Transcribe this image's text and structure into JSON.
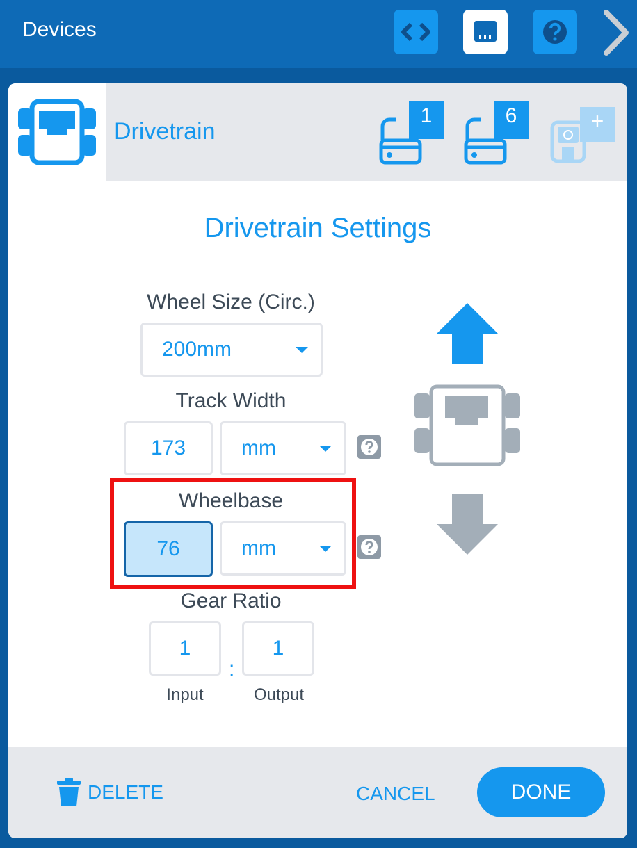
{
  "topbar": {
    "title": "Devices",
    "icons": [
      "code-icon",
      "devices-icon",
      "help-icon",
      "chevron-right-icon"
    ]
  },
  "device": {
    "title": "Drivetrain",
    "ports": [
      {
        "label": "1"
      },
      {
        "label": "6"
      },
      {
        "label": "+"
      }
    ]
  },
  "settings": {
    "title": "Drivetrain Settings",
    "wheel_size": {
      "label": "Wheel Size (Circ.)",
      "value": "200mm"
    },
    "track_width": {
      "label": "Track Width",
      "value": "173",
      "unit": "mm"
    },
    "wheelbase": {
      "label": "Wheelbase",
      "value": "76",
      "unit": "mm"
    },
    "gear_ratio": {
      "label": "Gear Ratio",
      "input": "1",
      "output": "1",
      "separator": ":",
      "input_label": "Input",
      "output_label": "Output"
    },
    "help_glyph": "?"
  },
  "footer": {
    "delete_label": "DELETE",
    "cancel_label": "CANCEL",
    "done_label": "DONE"
  },
  "colors": {
    "topbar": "#0e6ab6",
    "accent": "#1597ee",
    "panel_gray": "#e6e8ec",
    "text_dark": "#3d4a57",
    "highlight": "#ee1111",
    "robot_gray": "#a3aeb8"
  }
}
